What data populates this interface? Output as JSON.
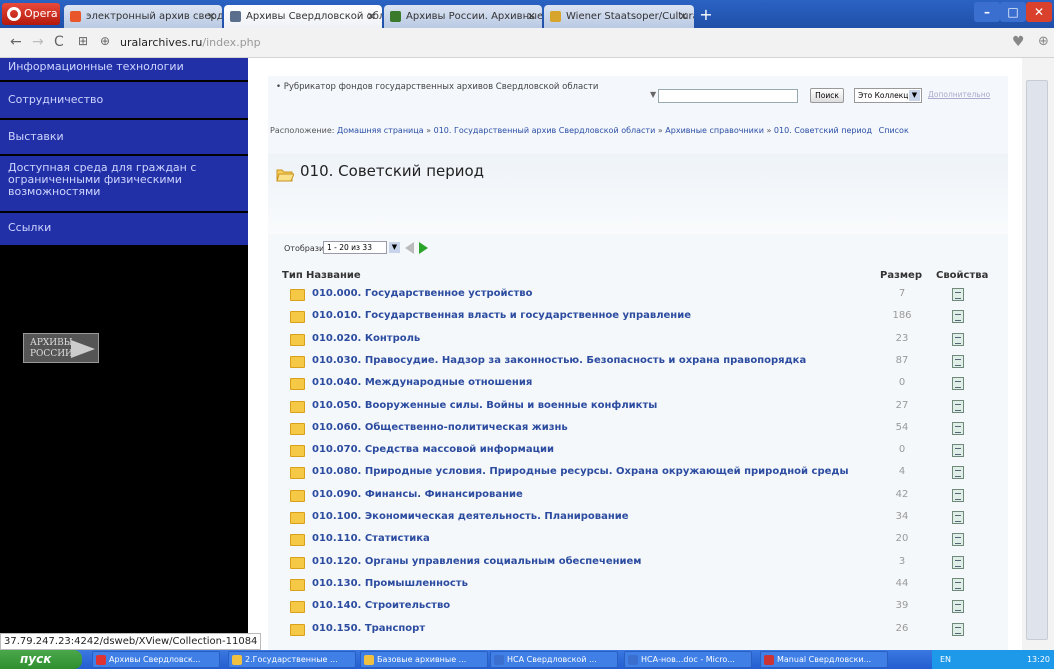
{
  "browser": {
    "menu_label": "Opera",
    "tabs": [
      {
        "label": "электронный архив свердл",
        "color": "#e8562a"
      },
      {
        "label": "Архивы Свердловской обл",
        "color": "#5a6f8c"
      },
      {
        "label": "Архивы России. Архивные",
        "color": "#3a7a2a"
      },
      {
        "label": "Wiener Staatsoper/Cultural",
        "color": "#d7a52c"
      }
    ],
    "new_tab": "+",
    "url_host": "uralarchives.ru",
    "url_path": "/index.php"
  },
  "sidebar": {
    "items": [
      {
        "label": "Информационные технологии"
      },
      {
        "label": "Сотрудничество"
      },
      {
        "label": "Выставки"
      },
      {
        "lines": [
          "Доступная среда для граждан с",
          "ограниченными физическими",
          "возможностями"
        ]
      },
      {
        "label": "Ссылки"
      }
    ],
    "banner_text": [
      "АРХИВЫ",
      "РОССИИ"
    ]
  },
  "main": {
    "rubricator": "• Рубрикатор фондов государственных архивов Свердловской области",
    "search_value": "",
    "search_button": "Поиск",
    "collection_select": "Это Коллекция",
    "advanced_link": "Дополнительно",
    "breadcrumb": {
      "prefix": "Расположение:",
      "items": [
        "Домашняя страница",
        "010. Государственный архив Свердловской области",
        "Архивные справочники",
        "010. Советский период"
      ],
      "separator": "»",
      "suffix": "Список"
    },
    "page_title": "010. Советский период",
    "pager": {
      "label": "Отобразить:",
      "value": "1 - 20 из 33"
    },
    "columns": {
      "type": "Тип",
      "name": "Название",
      "size": "Размер",
      "props": "Свойства"
    },
    "rows": [
      {
        "name": "010.000. Государственное устройство",
        "size": "7"
      },
      {
        "name": "010.010. Государственная власть и государственное управление",
        "size": "186"
      },
      {
        "name": "010.020. Контроль",
        "size": "23"
      },
      {
        "name": "010.030. Правосудие. Надзор за законностью. Безопасность и охрана правопорядка",
        "size": "87"
      },
      {
        "name": "010.040. Международные отношения",
        "size": "0"
      },
      {
        "name": "010.050. Вооруженные силы. Войны и военные конфликты",
        "size": "27"
      },
      {
        "name": "010.060. Общественно-политическая жизнь",
        "size": "54"
      },
      {
        "name": "010.070. Средства массовой информации",
        "size": "0"
      },
      {
        "name": "010.080. Природные условия. Природные ресурсы. Охрана окружающей природной среды",
        "size": "4"
      },
      {
        "name": "010.090. Финансы. Финансирование",
        "size": "42"
      },
      {
        "name": "010.100. Экономическая деятельность. Планирование",
        "size": "34"
      },
      {
        "name": "010.110. Статистика",
        "size": "20"
      },
      {
        "name": "010.120. Органы управления социальным обеспечением",
        "size": "3"
      },
      {
        "name": "010.130. Промышленность",
        "size": "44"
      },
      {
        "name": "010.140. Строительство",
        "size": "39"
      },
      {
        "name": "010.150. Транспорт",
        "size": "26"
      }
    ]
  },
  "status_url": "37.79.247.23:4242/dsweb/XView/Collection-11084",
  "taskbar": {
    "start": "пуск",
    "tasks": [
      {
        "label": "Архивы Свердловск...",
        "color": "#d33"
      },
      {
        "label": "2.Государственные ...",
        "color": "#f0c040"
      },
      {
        "label": "Базовые архивные ...",
        "color": "#f0c040"
      },
      {
        "label": "НСА Свердловской ...",
        "color": "#3a6fd0"
      },
      {
        "label": "НСА-нов...doc - Micro...",
        "color": "#3a6fd0"
      },
      {
        "label": "Manual Свердловски...",
        "color": "#c33"
      }
    ],
    "tray_lang": "EN",
    "clock": "13:20"
  }
}
